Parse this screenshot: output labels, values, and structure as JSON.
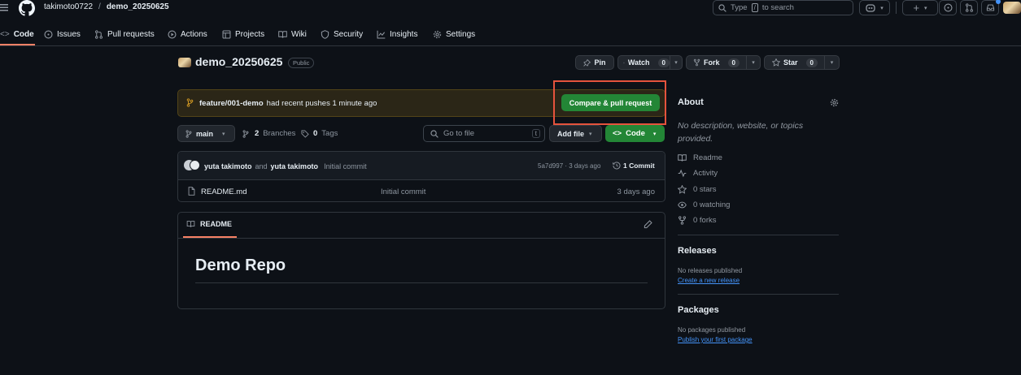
{
  "header": {
    "owner": "takimoto0722",
    "separator": "/",
    "repo": "demo_20250625",
    "search_placeholder": "Type / to search",
    "search_key": "/",
    "search_prefix": "Type",
    "search_suffix": "to search"
  },
  "tabs": [
    {
      "label": "Code",
      "icon": "code-icon"
    },
    {
      "label": "Issues",
      "icon": "issue-icon"
    },
    {
      "label": "Pull requests",
      "icon": "pull-request-icon"
    },
    {
      "label": "Actions",
      "icon": "play-icon"
    },
    {
      "label": "Projects",
      "icon": "table-icon"
    },
    {
      "label": "Wiki",
      "icon": "book-icon"
    },
    {
      "label": "Security",
      "icon": "shield-icon"
    },
    {
      "label": "Insights",
      "icon": "graph-icon"
    },
    {
      "label": "Settings",
      "icon": "gear-icon"
    }
  ],
  "repo": {
    "name": "demo_20250625",
    "visibility": "Public",
    "pin_label": "Pin",
    "watch_label": "Watch",
    "watch_count": "0",
    "fork_label": "Fork",
    "fork_count": "0",
    "star_label": "Star",
    "star_count": "0"
  },
  "banner": {
    "branch": "feature/001-demo",
    "message": "had recent pushes 1 minute ago",
    "button": "Compare & pull request"
  },
  "toolbar": {
    "branch": "main",
    "branches_count": "2",
    "branches_label": "Branches",
    "tags_count": "0",
    "tags_label": "Tags",
    "go_to_file": "Go to file",
    "go_to_file_key": "t",
    "add_file": "Add file",
    "code": "Code"
  },
  "commit": {
    "author1": "yuta takimoto",
    "and": "and",
    "author2": "yuta takimoto",
    "message": "Initial commit",
    "hash_time": "5a7d997 · 3 days ago",
    "commits": "1 Commit"
  },
  "files": [
    {
      "name": "README.md",
      "message": "Initial commit",
      "time": "3 days ago"
    }
  ],
  "readme": {
    "tab": "README",
    "heading": "Demo Repo"
  },
  "about": {
    "title": "About",
    "description": "No description, website, or topics provided.",
    "readme": "Readme",
    "activity": "Activity",
    "stars": "0 stars",
    "watching": "0 watching",
    "forks": "0 forks"
  },
  "releases": {
    "title": "Releases",
    "none": "No releases published",
    "create": "Create a new release"
  },
  "packages": {
    "title": "Packages",
    "none": "No packages published",
    "publish": "Publish your first package"
  },
  "colors": {
    "accent_green": "#238636",
    "highlight_red": "#e5533d",
    "tab_underline": "#f78166",
    "link_blue": "#4493f8"
  }
}
